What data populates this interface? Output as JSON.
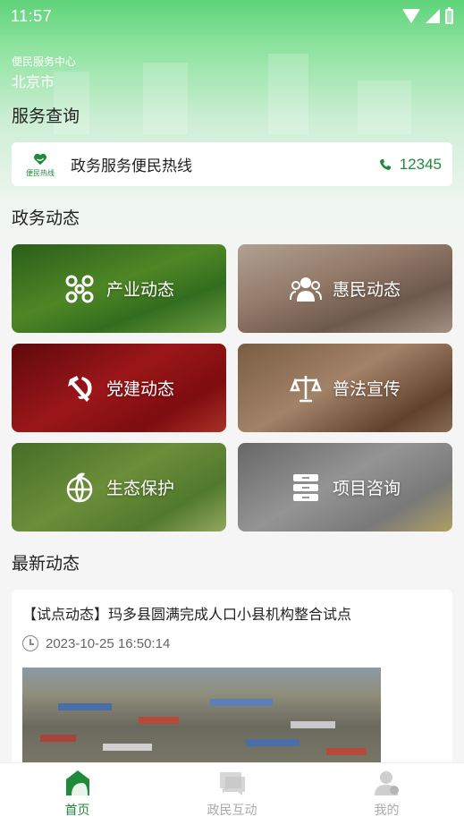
{
  "status_bar": {
    "time": "11:57"
  },
  "header": {
    "service_center": "便民服务中心",
    "city": "北京市"
  },
  "service_query": {
    "title": "服务查询",
    "hotline": {
      "logo_text": "便民热线",
      "label": "政务服务便民热线",
      "number": "12345"
    }
  },
  "gov_news": {
    "title": "政务动态",
    "tiles": [
      {
        "label": "产业动态",
        "icon": "network-icon"
      },
      {
        "label": "惠民动态",
        "icon": "people-icon"
      },
      {
        "label": "党建动态",
        "icon": "hammer-sickle-icon"
      },
      {
        "label": "普法宣传",
        "icon": "scales-icon"
      },
      {
        "label": "生态保护",
        "icon": "globe-leaf-icon"
      },
      {
        "label": "项目咨询",
        "icon": "database-icon"
      }
    ]
  },
  "latest": {
    "title": "最新动态",
    "article": {
      "title": "【试点动态】玛多县圆满完成人口小县机构整合试点",
      "time": "2023-10-25 16:50:14"
    }
  },
  "tab_bar": {
    "tabs": [
      {
        "label": "首页",
        "active": true
      },
      {
        "label": "政民互动",
        "active": false
      },
      {
        "label": "我的",
        "active": false
      }
    ]
  },
  "colors": {
    "accent": "#1f8a3a",
    "header_green": "#5fd37a"
  }
}
